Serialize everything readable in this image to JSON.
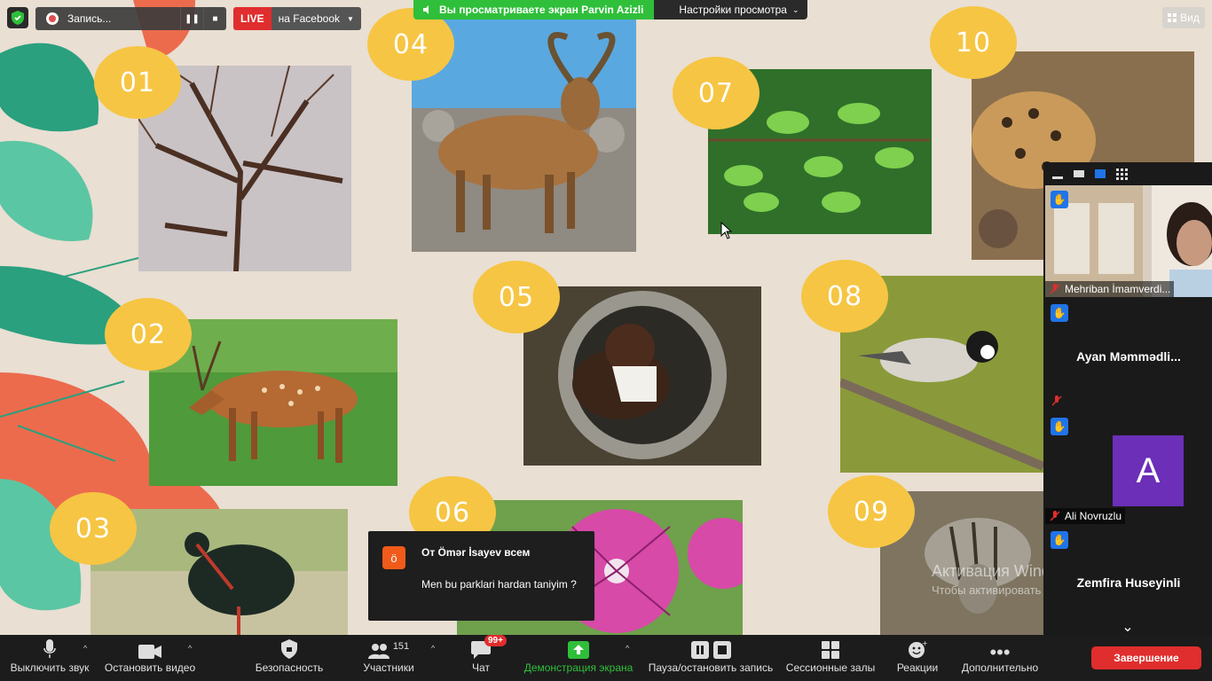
{
  "recording": {
    "label": "Запись...",
    "live": "LIVE",
    "stream_target": "на Facebook"
  },
  "banner": {
    "viewing_text": "Вы просматриваете экран Parvin Azizli",
    "settings_label": "Настройки просмотра"
  },
  "view_button": "Вид",
  "slide": {
    "badges": [
      "01",
      "02",
      "03",
      "04",
      "05",
      "06",
      "07",
      "08",
      "09",
      "10"
    ],
    "photos": [
      "bare tree",
      "sika deer",
      "black stork",
      "wild goat",
      "marten",
      "pink flower",
      "green leaves",
      "nuthatch bird",
      "hyena",
      "leopard"
    ]
  },
  "participants": [
    {
      "name": "Mehriban İmamverdi...",
      "type": "video",
      "raised_hand": true,
      "muted": true
    },
    {
      "name": "Ayan  Məmmədli...",
      "type": "name",
      "raised_hand": true,
      "muted": true
    },
    {
      "name": "Ali Novruzlu",
      "type": "avatar",
      "avatar_letter": "A",
      "avatar_color": "#6b2fb8",
      "raised_hand": true,
      "muted": true
    },
    {
      "name": "Zemfira Huseyinli",
      "type": "name",
      "raised_hand": true,
      "muted": true
    }
  ],
  "chat_toast": {
    "avatar_letter": "ö",
    "from": "От Ömər İsayev всем",
    "message": "Men bu parklari hardan taniyim ?"
  },
  "watermark": {
    "line1": "Активация Windows",
    "line2": "Чтобы активировать Windows, перейдите в"
  },
  "toolbar": {
    "mute": "Выключить звук",
    "video": "Остановить видео",
    "security": "Безопасность",
    "participants": "Участники",
    "participants_count": "151",
    "chat": "Чат",
    "chat_badge": "99+",
    "share": "Демонстрация экрана",
    "record": "Пауза/остановить запись",
    "breakout": "Сессионные залы",
    "reactions": "Реакции",
    "more": "Дополнительно",
    "end": "Завершение"
  },
  "colors": {
    "badge": "#f6c543",
    "share_green": "#2fbf3a",
    "end_red": "#e02d2d",
    "raise_hand_blue": "#1f74e8",
    "slide_bg": "#e9dfd2"
  }
}
